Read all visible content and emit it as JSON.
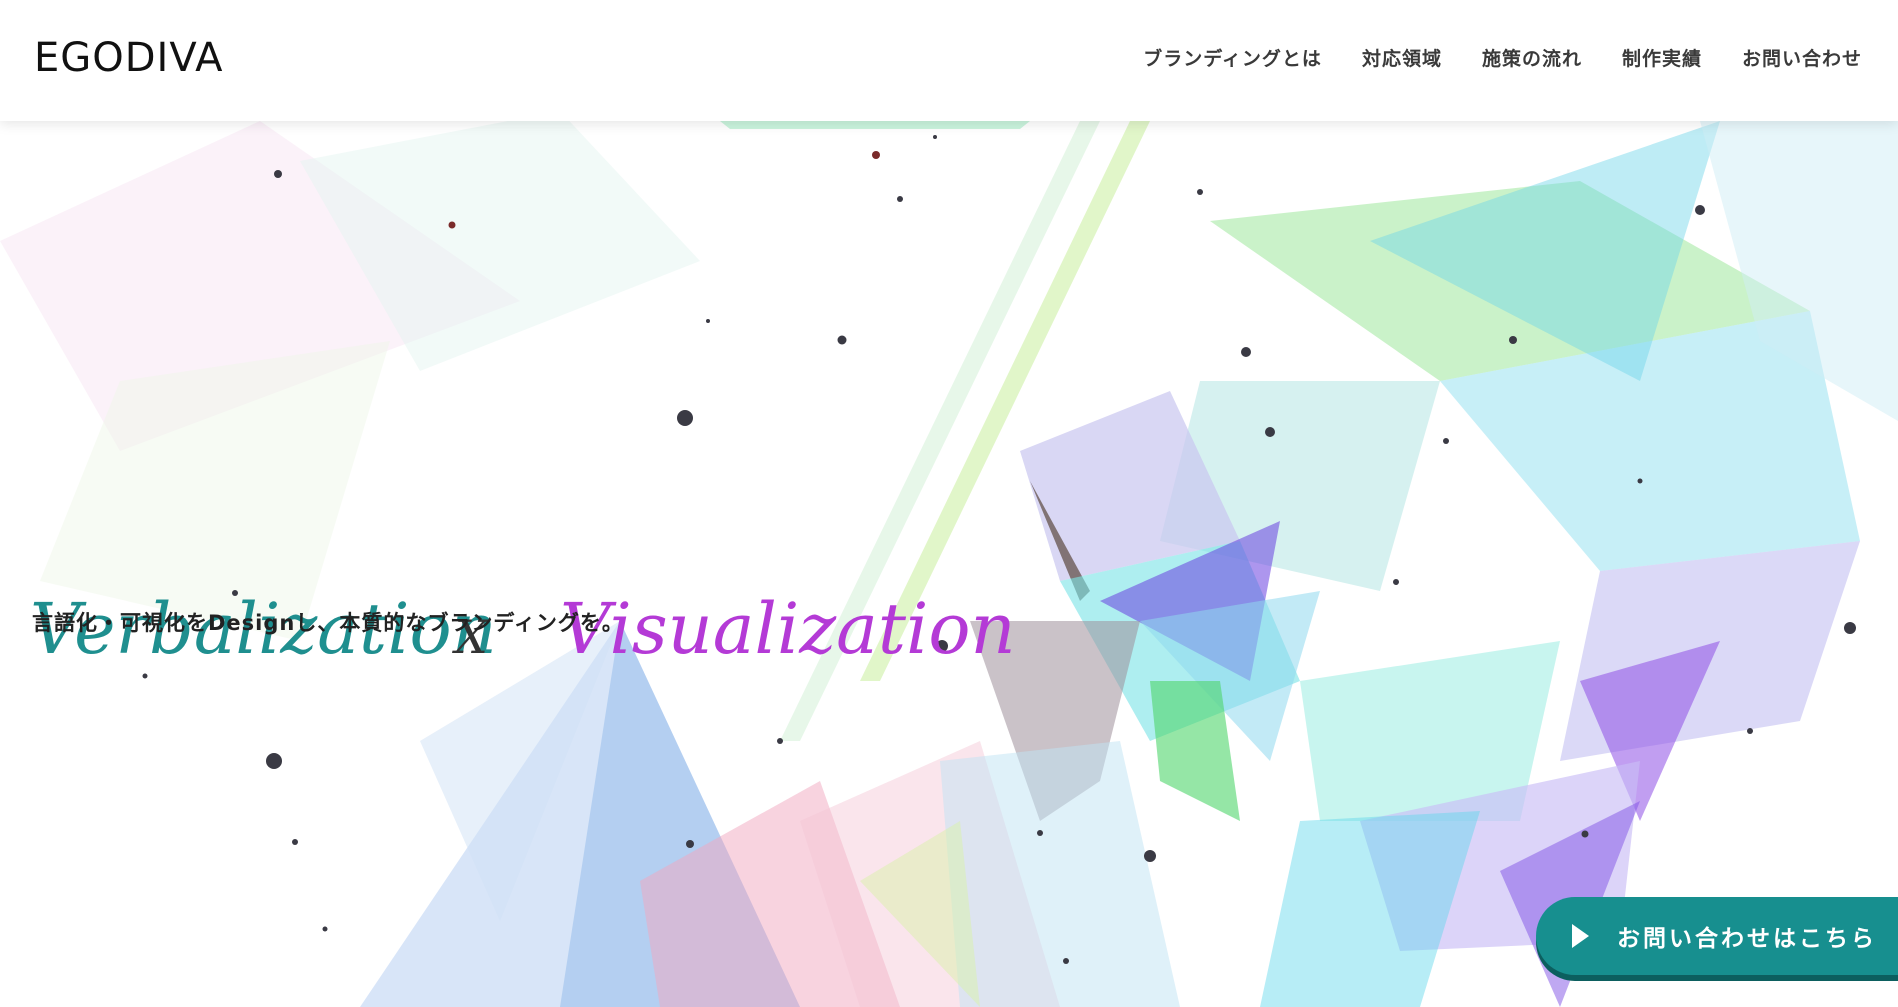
{
  "header": {
    "logo_text": "EGODIVA",
    "nav": [
      {
        "label": "ブランディングとは"
      },
      {
        "label": "対応領域"
      },
      {
        "label": "施策の流れ"
      },
      {
        "label": "制作実績"
      },
      {
        "label": "お問い合わせ"
      }
    ]
  },
  "hero": {
    "tagline_left": "Verbalization",
    "tagline_x": "X",
    "tagline_right": "Visualization",
    "subcopy": "言語化・可視化をDesignし、本質的なブランディングを。",
    "colors": {
      "left": "#1f8f8f",
      "x": "#333333",
      "right": "#b43ad6"
    }
  },
  "cta": {
    "label": "お問い合わせはこちら",
    "icon": "play-icon",
    "color": "#178f8f"
  }
}
